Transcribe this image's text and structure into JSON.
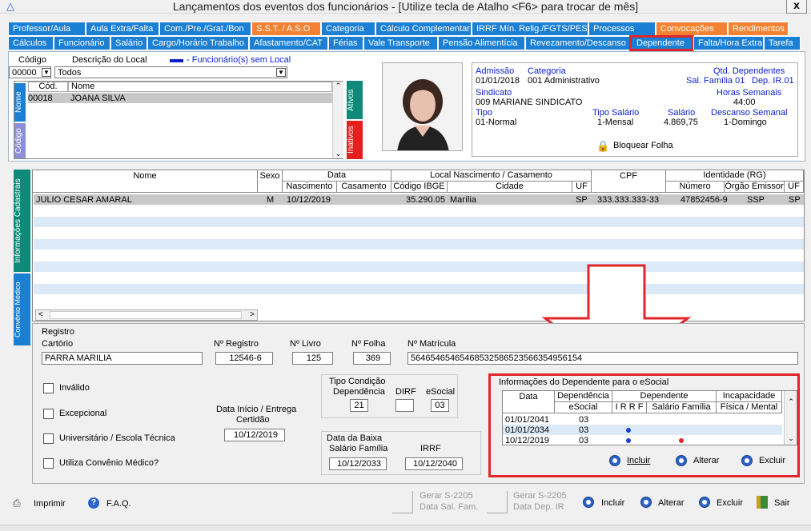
{
  "window": {
    "title": "Lançamentos dos eventos dos funcionários - [Utilize tecla de Atalho <F6> para trocar de mês]",
    "close": "x",
    "icon": "app-triangle-icon"
  },
  "tabs_row1": [
    "Professor/Aula",
    "Aula Extra/Falta",
    "Com./Pre./Grat./Bon",
    "S.S.T. / A.S.O",
    "Categoria",
    "Cálculo Complementar",
    "IRRF Mín. Relig./FGTS/PESP",
    "Processos",
    "Convocações",
    "Rendimentos"
  ],
  "tabs_row2": [
    "Cálculos",
    "Funcionário",
    "Salário",
    "Cargo/Horário Trabalho",
    "Afastamento/CAT",
    "Férias",
    "Vale Transporte",
    "Pensão Alimentícia",
    "Revezamento/Descanso",
    "Dependente",
    "Falta/Hora Extra",
    "Tarefa"
  ],
  "local": {
    "codigo_label": "Código",
    "descricao_label": "Descrição do Local",
    "legend": "- Funcionário(s) sem Local",
    "codigo": "00000",
    "descricao": "Todos"
  },
  "emplist": {
    "col_cod": "Cód.",
    "col_nome": "Nome",
    "rows": [
      {
        "cod": "00018",
        "nome": "JOANA SILVA"
      }
    ],
    "vtab_nome": "Nome",
    "vtab_codigo": "Código",
    "vtab_ativos": "Ativos",
    "vtab_inativos": "Inativos"
  },
  "info": {
    "admissao_label": "Admissão",
    "admissao": "01/01/2018",
    "categoria_label": "Categoria",
    "categoria": "001  Administrativo",
    "qtd_label": "Qtd. Dependentes",
    "salfam": "Sal. Família 01",
    "depir": "Dep. IR.01",
    "sindicato_label": "Sindicato",
    "sindicato": "009  MARIANE SINDICATO",
    "horas_label": "Horas Semanais",
    "horas": "44:00",
    "tipo_label": "Tipo",
    "tipo": "01-Normal",
    "tiposal_label": "Tipo Salário",
    "tiposal": "1-Mensal",
    "salario_label": "Salário",
    "salario": "4.869,75",
    "descanso_label": "Descanso Semanal",
    "descanso": "1-Domingo",
    "bloquear": "Bloquear Folha"
  },
  "sidetabs": {
    "cadastrais": "Informações Cadastrais",
    "convenio": "Convênio Médico"
  },
  "grid": {
    "h_nome": "Nome",
    "h_sexo": "Sexo",
    "h_data": "Data",
    "h_nasc": "Nascimento",
    "h_cas": "Casamento",
    "h_local": "Local Nascimento / Casamento",
    "h_ibge": "Código IBGE",
    "h_cidade": "Cidade",
    "h_uf": "UF",
    "h_cpf": "CPF",
    "h_ident": "Identidade (RG)",
    "h_numero": "Número",
    "h_orgao": "Órgão Emissor",
    "h_uf2": "UF",
    "rows": [
      {
        "nome": "JULIO CESAR AMARAL",
        "sexo": "M",
        "nasc": "10/12/2019",
        "cas": "",
        "ibge": "35.290.05",
        "cidade": "Marília",
        "uf": "SP",
        "cpf": "333.333.333-33",
        "numero": "47852456-9",
        "orgao": "SSP",
        "uf2": "SP"
      }
    ]
  },
  "registro": {
    "title": "Registro",
    "cartorio_label": "Cartório",
    "cartorio": "PARRA MARILIA",
    "nreg_label": "Nº Registro",
    "nreg": "12546-6",
    "nlivro_label": "Nº Livro",
    "nlivro": "125",
    "nfolha_label": "Nº Folha",
    "nfolha": "369",
    "nmat_label": "Nº Matrícula",
    "nmat": "56465465465468532586523566354956154"
  },
  "checks": {
    "invalido": "Inválido",
    "excepcional": "Excepcional",
    "universitario": "Universitário / Escola Técnica",
    "convenio": "Utiliza Convênio Médico?"
  },
  "certidao": {
    "label1": "Data Início / Entrega",
    "label2": "Certidão",
    "value": "10/12/2019"
  },
  "condicao": {
    "title1": "Tipo Condição",
    "title2": "Dependência",
    "value": "21",
    "dirf_label": "DIRF",
    "dirf": "",
    "esocial_label": "eSocial",
    "esocial": "03"
  },
  "baixa": {
    "title": "Data da Baixa",
    "salfam_label": "Salário Família",
    "salfam": "10/12/2033",
    "irrf_label": "IRRF",
    "irrf": "10/12/2040"
  },
  "esocial": {
    "title": "Informações do Dependente para o eSocial",
    "h_data": "Data",
    "h_dep": "Dependência",
    "h_dep2": "eSocial",
    "h_dependente": "Dependente",
    "h_irrf": "I R R F",
    "h_salfam": "Salário Família",
    "h_incap": "Incapacidade",
    "h_incap2": "Física / Mental",
    "rows": [
      {
        "data": "01/01/2041",
        "dep": "03"
      },
      {
        "data": "01/01/2034",
        "dep": "03"
      },
      {
        "data": "10/12/2019",
        "dep": "03"
      }
    ]
  },
  "es_buttons": {
    "incluir": "Incluir",
    "alterar": "Alterar",
    "excluir": "Excluir"
  },
  "bottom": {
    "imprimir": "Imprimir",
    "faq": "F.A.Q.",
    "s2205a_1": "Gerar S-2205",
    "s2205a_2": "Data Sal. Fam.",
    "s2205b_1": "Gerar S-2205",
    "s2205b_2": "Data Dep. IR",
    "incluir": "Incluir",
    "alterar": "Alterar",
    "excluir": "Excluir",
    "sair": "Sair"
  },
  "colors": {
    "tab_blue": "#1b7fd4",
    "tab_orange": "#f58232",
    "highlight_red": "#e0262b",
    "stripe": "#dce9f7"
  }
}
